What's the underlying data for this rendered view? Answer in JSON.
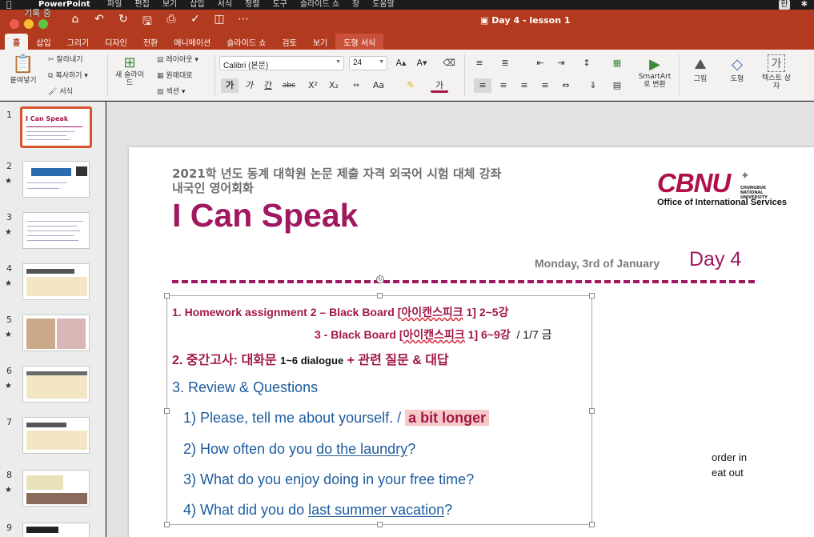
{
  "menubar": {
    "app_name": "PowerPoint",
    "items": [
      "파일",
      "편집",
      "보기",
      "삽입",
      "서식",
      "정렬",
      "도구",
      "슬라이드 쇼",
      "창",
      "도움말"
    ],
    "recording_label": "기록 중",
    "input_indicator": "한"
  },
  "window": {
    "document_title": "Day 4 - lesson 1"
  },
  "ribbon": {
    "tabs": [
      "홈",
      "삽입",
      "그리기",
      "디자인",
      "전환",
      "애니메이션",
      "슬라이드 쇼",
      "검토",
      "보기",
      "도형 서식"
    ],
    "active_tab": "홈",
    "clipboard": {
      "paste": "붙여넣기",
      "cut": "잘라내기",
      "copy": "복사하기",
      "format": "서식"
    },
    "slides": {
      "new_slide": "새 슬라이드",
      "layout": "레이아웃",
      "reset": "원래대로",
      "section": "섹션"
    },
    "font": {
      "name": "Calibri (본문)",
      "size": "24",
      "bold": "가",
      "italic": "가",
      "underline": "간",
      "strike": "abc"
    },
    "smartart": "SmartArt 로 변환",
    "picture": "그림",
    "shape": "도형",
    "textbox": "텍스트 상자",
    "textbox_icon": "가"
  },
  "thumbnails": [
    {
      "num": "1",
      "star": false,
      "title": "I Can Speak"
    },
    {
      "num": "2",
      "star": true
    },
    {
      "num": "3",
      "star": true
    },
    {
      "num": "4",
      "star": true
    },
    {
      "num": "5",
      "star": true
    },
    {
      "num": "6",
      "star": true
    },
    {
      "num": "7",
      "star": false
    },
    {
      "num": "8",
      "star": true
    },
    {
      "num": "9",
      "star": false
    }
  ],
  "slide": {
    "subtitle_line1": "2021학 년도 동계 대학원 논문 제출 자격 외국어 시험 대체 강좌",
    "subtitle_line2": "내국인 영어회화",
    "title": "I Can Speak",
    "logo_mark": "CBNU",
    "logo_tagline": "CHUNGBUK NATIONAL UNIVERSITY",
    "logo_office": "Office of International Services",
    "date": "Monday, 3rd of January",
    "day": "Day 4",
    "content": {
      "hw1_prefix": "1.   Homework assignment 2 – Black Board [",
      "hw1_korean": "아이캔스피크",
      "hw1_suffix": " 1]  2~5강",
      "hw2_prefix": "3 -  Black Board [",
      "hw2_korean": "아이캔스피크",
      "hw2_suffix": " 1]  6~9강",
      "hw2_date": "/ 1/7 금",
      "midterm_a": "2. 중간고사: 대화문 ",
      "midterm_b": "1~6 dialogue",
      "midterm_c": " +   관련 질문 & 대답",
      "review_heading": "3. Review & Questions",
      "q1": "1) Please, tell me about yourself. / ",
      "q1_highlight": "a bit longer",
      "q2_a": "2) How often do you ",
      "q2_u": "do the laundry",
      "q2_b": "?",
      "q3": "3) What do you enjoy doing in your free time?",
      "q4_a": "4) What did you do ",
      "q4_u": "last summer vacation",
      "q4_b": "?"
    },
    "side_note_1": "order in",
    "side_note_2": "eat out"
  },
  "colors": {
    "titlebar": "#b23b1f",
    "accent_magenta": "#a01860",
    "blue_text": "#1e5c9e"
  }
}
